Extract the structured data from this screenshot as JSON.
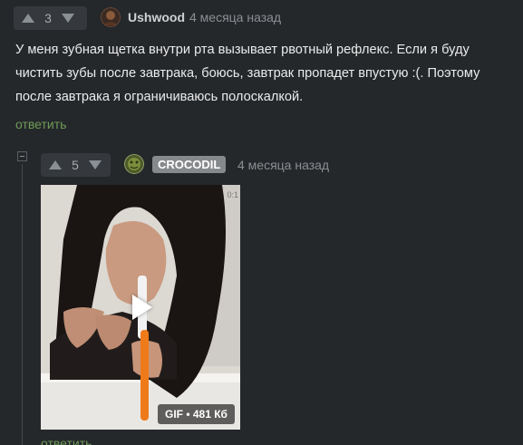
{
  "comment1": {
    "rating": "3",
    "username": "Ushwood",
    "time": "4 месяца назад",
    "text": "У меня зубная щетка внутри рта вызывает рвотный рефлекс. Если я буду чистить зубы после завтрака, боюсь, завтрак пропадет впустую :(. Поэтому после завтрака я ограничиваюсь полоскалкой.",
    "reply": "ответить"
  },
  "comment2": {
    "rating": "5",
    "username": "CROCODIL",
    "time": "4 месяца назад",
    "media_label": "GIF • 481 Кб",
    "timecode": "0:1",
    "reply": "ответить"
  },
  "colors": {
    "background": "#25282b",
    "reply_link": "#6f9b57",
    "username_badge": "#86898b"
  },
  "icons": [
    "upvote-icon",
    "downvote-icon",
    "play-icon",
    "collapse-icon"
  ]
}
